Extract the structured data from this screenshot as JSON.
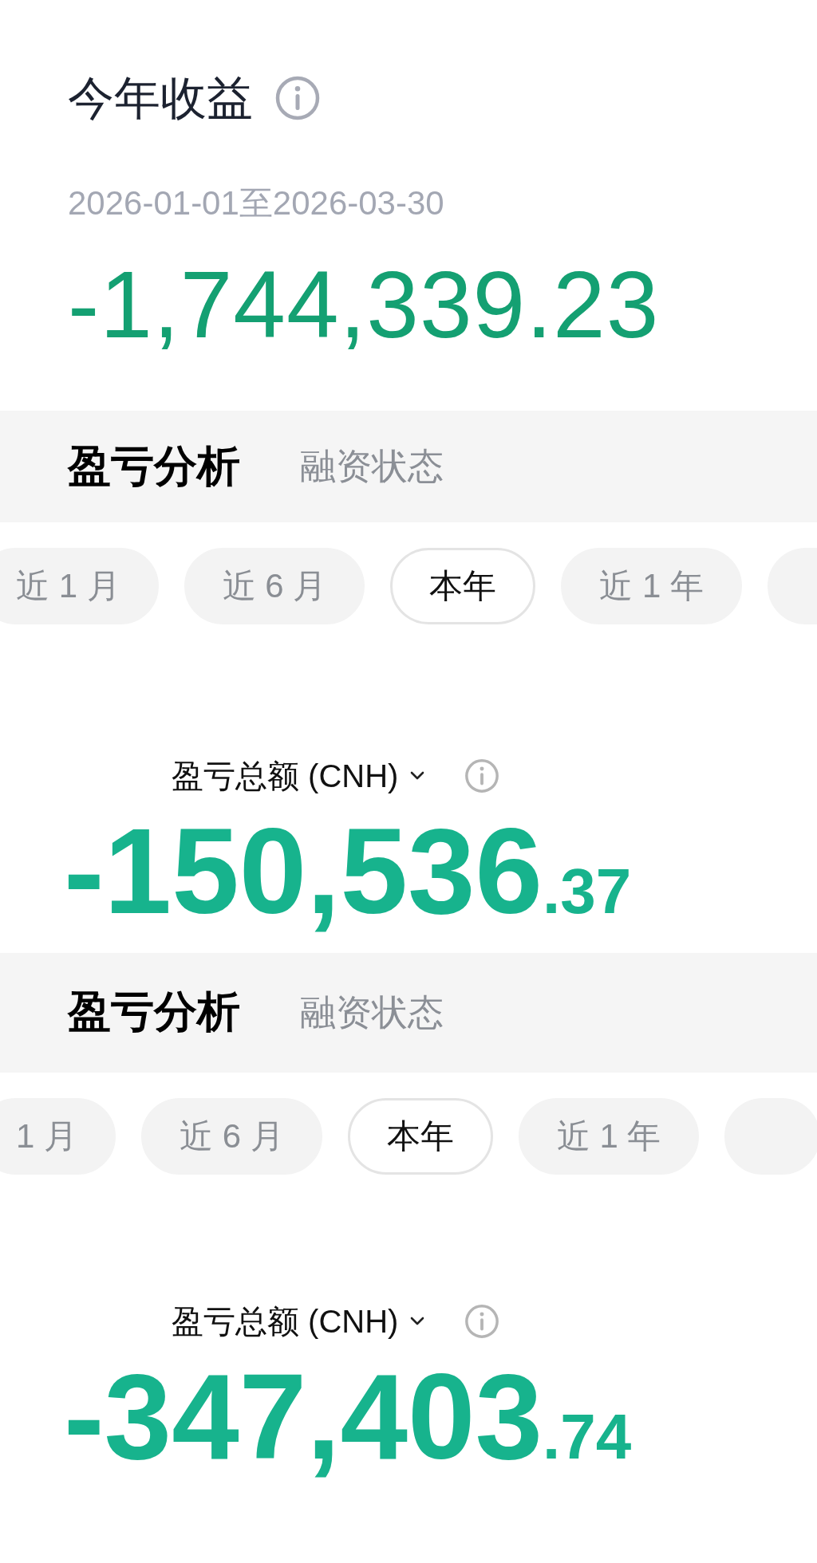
{
  "summary": {
    "title": "今年收益",
    "date_range": "2026-01-01至2026-03-30",
    "amount": "-1,744,339.23"
  },
  "panels": [
    {
      "tabs": [
        {
          "label": "盈亏分析",
          "selected": true
        },
        {
          "label": "融资状态",
          "selected": false
        }
      ],
      "periods": [
        {
          "label": "近 1 月",
          "selected": false
        },
        {
          "label": "近 6 月",
          "selected": false
        },
        {
          "label": "本年",
          "selected": true
        },
        {
          "label": "近 1 年",
          "selected": false
        },
        {
          "selected": false
        }
      ],
      "total": {
        "label": "盈亏总额 (CNH)",
        "integer": "-150,536",
        "decimal": ".37"
      }
    },
    {
      "tabs": [
        {
          "label": "盈亏分析",
          "selected": true
        },
        {
          "label": "融资状态",
          "selected": false
        }
      ],
      "periods": [
        {
          "label": "1 月",
          "selected": false
        },
        {
          "label": "近 6 月",
          "selected": false
        },
        {
          "label": "本年",
          "selected": true
        },
        {
          "label": "近 1 年",
          "selected": false
        },
        {
          "selected": false
        }
      ],
      "total": {
        "label": "盈亏总额 (CNH)",
        "integer": "-347,403",
        "decimal": ".74"
      }
    }
  ]
}
